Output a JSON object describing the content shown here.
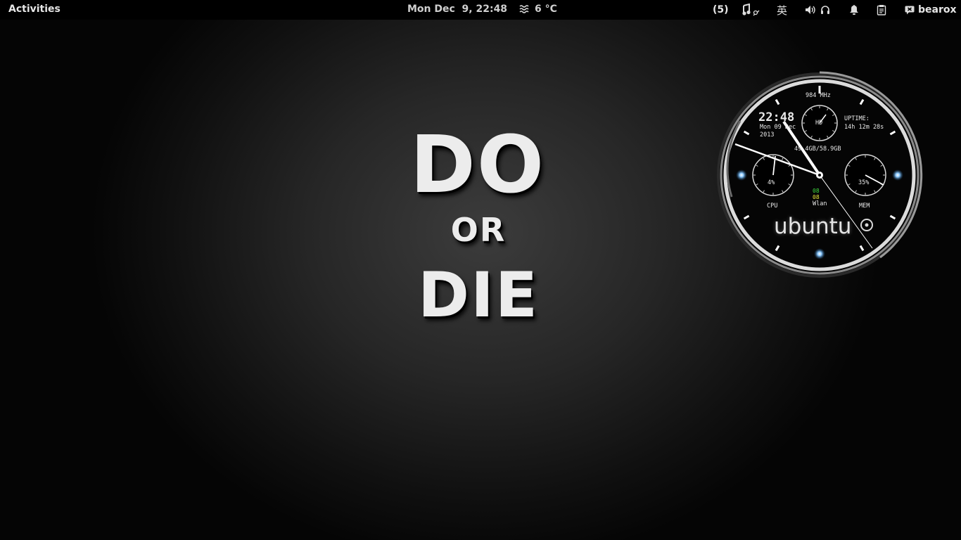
{
  "topbar": {
    "activities_label": "Activities",
    "datetime": "Mon Dec  9, 22:48",
    "weather_temp": "6 °C",
    "notification_count": "(5)",
    "input_method": "英",
    "username": "bearox"
  },
  "wallpaper": {
    "line1": "DO",
    "line2": "OR",
    "line3": "DIE"
  },
  "clock_widget": {
    "time": "22:48",
    "date_line1": "Mon 09 Dec",
    "date_line2": "2013",
    "cpu_freq": "984 MHz",
    "hd_label": "HD",
    "uptime_label": "UPTIME:",
    "uptime_value": "14h 12m 28s",
    "disk_usage": "49.4GB/58.9GB",
    "cpu_percent": "4%",
    "cpu_label": "CPU",
    "mem_percent": "35%",
    "mem_label": "MEM",
    "wlan_up": "08",
    "wlan_down": "08",
    "wlan_label": "Wlan",
    "brand": "ubuntu",
    "colors": {
      "accent_glow": "#5fb4ff",
      "wlan_up": "#3fdc3f",
      "wlan_down": "#e6e63a"
    }
  }
}
